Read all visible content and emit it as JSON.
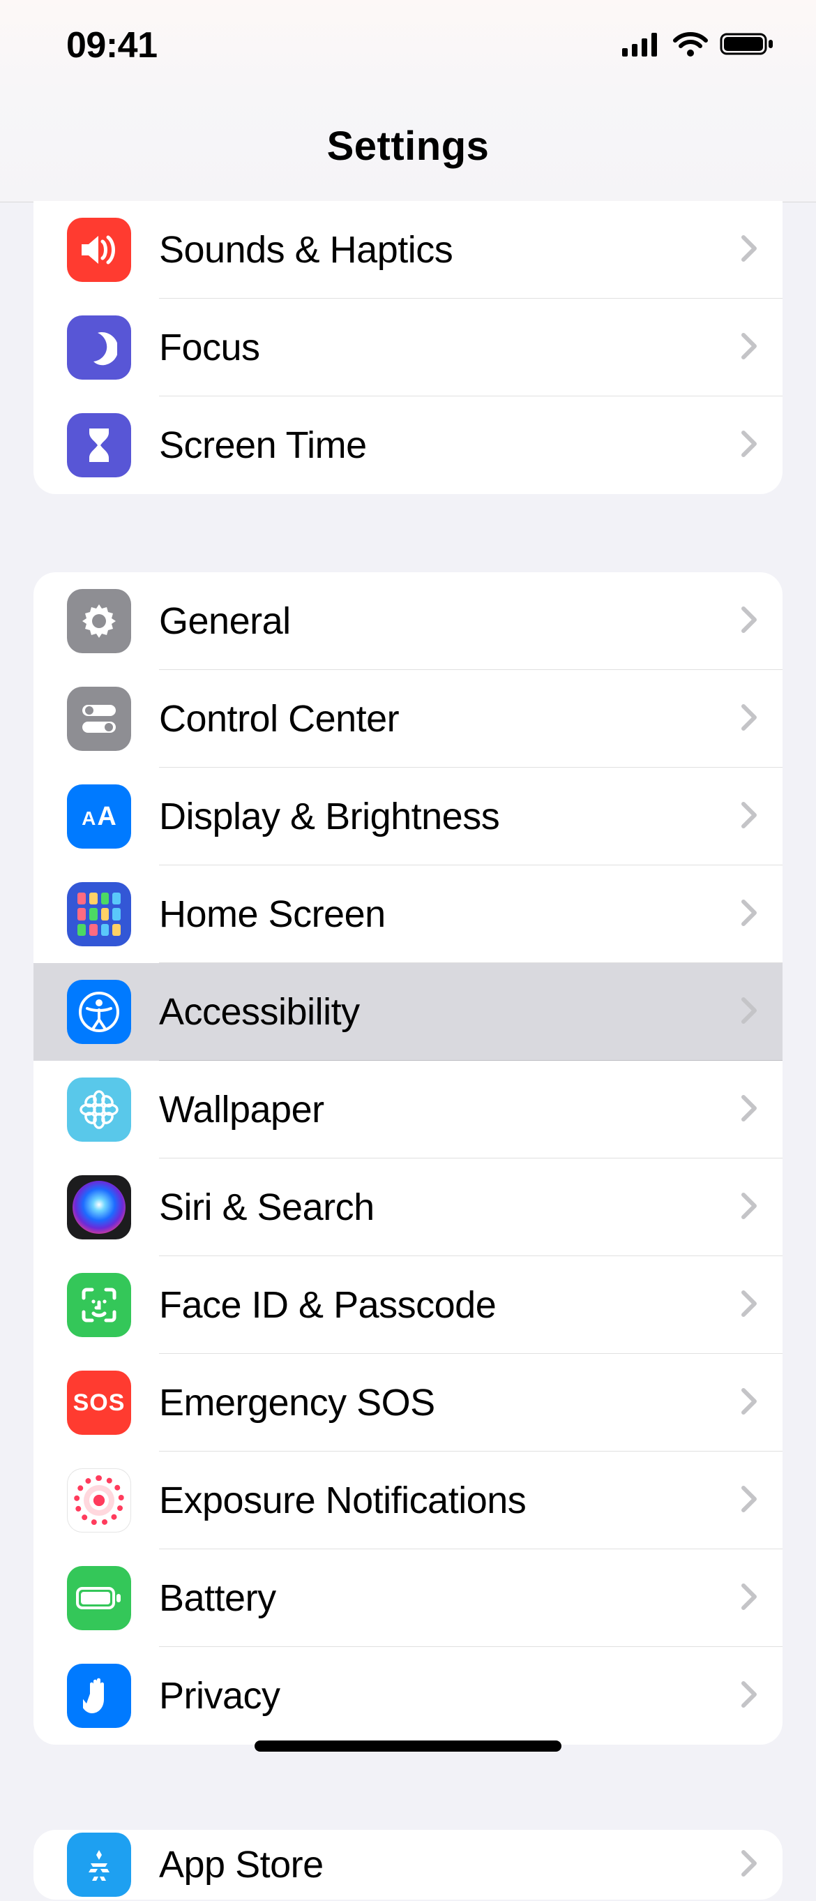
{
  "status": {
    "time": "09:41"
  },
  "header": {
    "title": "Settings"
  },
  "groups": [
    {
      "id": "g1",
      "items": [
        {
          "id": "sounds",
          "label": "Sounds & Haptics"
        },
        {
          "id": "focus",
          "label": "Focus"
        },
        {
          "id": "screentime",
          "label": "Screen Time"
        }
      ]
    },
    {
      "id": "g2",
      "items": [
        {
          "id": "general",
          "label": "General"
        },
        {
          "id": "controlcenter",
          "label": "Control Center"
        },
        {
          "id": "display",
          "label": "Display & Brightness"
        },
        {
          "id": "homescreen",
          "label": "Home Screen"
        },
        {
          "id": "accessibility",
          "label": "Accessibility",
          "selected": true
        },
        {
          "id": "wallpaper",
          "label": "Wallpaper"
        },
        {
          "id": "siri",
          "label": "Siri & Search"
        },
        {
          "id": "faceid",
          "label": "Face ID & Passcode"
        },
        {
          "id": "sos",
          "label": "Emergency SOS"
        },
        {
          "id": "exposure",
          "label": "Exposure Notifications"
        },
        {
          "id": "battery",
          "label": "Battery"
        },
        {
          "id": "privacy",
          "label": "Privacy"
        }
      ]
    },
    {
      "id": "g3",
      "items": [
        {
          "id": "appstore",
          "label": "App Store"
        }
      ]
    }
  ]
}
